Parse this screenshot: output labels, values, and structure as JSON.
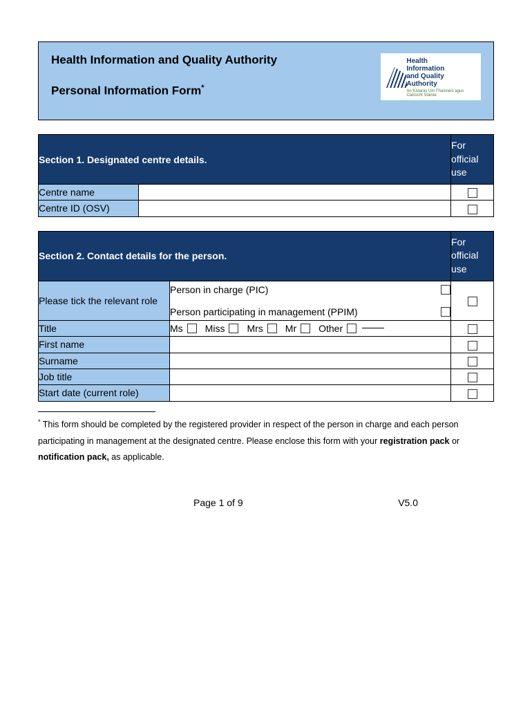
{
  "header": {
    "org_title": "Health Information and Quality Authority",
    "form_title": "Personal Information Form",
    "logo_line1": "Health",
    "logo_line2": "Information",
    "logo_line3": "and Quality",
    "logo_line4": "Authority",
    "logo_sub": "An tÚdarás Um Fhaisnéis agus Cáilíocht Sláinte"
  },
  "section1": {
    "title": "Section 1. Designated centre details.",
    "official": "For official use",
    "rows": {
      "centre_name": "Centre name",
      "centre_id": "Centre ID (OSV)"
    }
  },
  "section2": {
    "title": "Section 2. Contact details for the person.",
    "official": "For official use",
    "role_label": "Please tick the relevant role",
    "role_pic": "Person in charge (PIC)",
    "role_ppim": "Person participating in management (PPIM)",
    "title_label": "Title",
    "titles": {
      "ms": "Ms",
      "miss": "Miss",
      "mrs": "Mrs",
      "mr": "Mr",
      "other": "Other"
    },
    "first_name": "First name",
    "surname": "Surname",
    "job_title": "Job title",
    "start_date": "Start date (current role)"
  },
  "footnote": {
    "marker": "*",
    "text1": " This form should be completed by the registered provider in respect of the person in charge and each person participating in management at the designated centre. Please enclose this form with your ",
    "bold1": "registration pack",
    "text2": " or ",
    "bold2": "notification pack,",
    "text3": " as applicable."
  },
  "footer": {
    "page": "Page 1 of 9",
    "version": "V5.0"
  }
}
